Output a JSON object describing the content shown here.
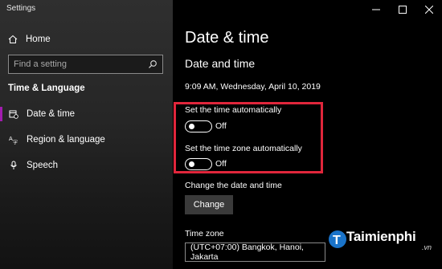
{
  "window": {
    "app_title": "Settings"
  },
  "sidebar": {
    "home_label": "Home",
    "search_placeholder": "Find a setting",
    "section_title": "Time & Language",
    "items": [
      {
        "label": "Date & time",
        "icon": "calendar-clock-icon",
        "active": true
      },
      {
        "label": "Region & language",
        "icon": "language-icon",
        "active": false
      },
      {
        "label": "Speech",
        "icon": "microphone-icon",
        "active": false
      }
    ]
  },
  "main": {
    "title": "Date & time",
    "subtitle": "Date and time",
    "current_datetime": "9:09 AM, Wednesday, April 10, 2019",
    "auto_time": {
      "label": "Set the time automatically",
      "state": "Off"
    },
    "auto_timezone": {
      "label": "Set the time zone automatically",
      "state": "Off"
    },
    "change_section_label": "Change the date and time",
    "change_button_label": "Change",
    "timezone_label": "Time zone",
    "timezone_value": "(UTC+07:00) Bangkok, Hanoi, Jakarta"
  },
  "watermark": {
    "text": "Taimienphi",
    "suffix": ".vn"
  },
  "colors": {
    "highlight": "#e0263b",
    "accent": "#a21caf",
    "background": "#000000"
  }
}
